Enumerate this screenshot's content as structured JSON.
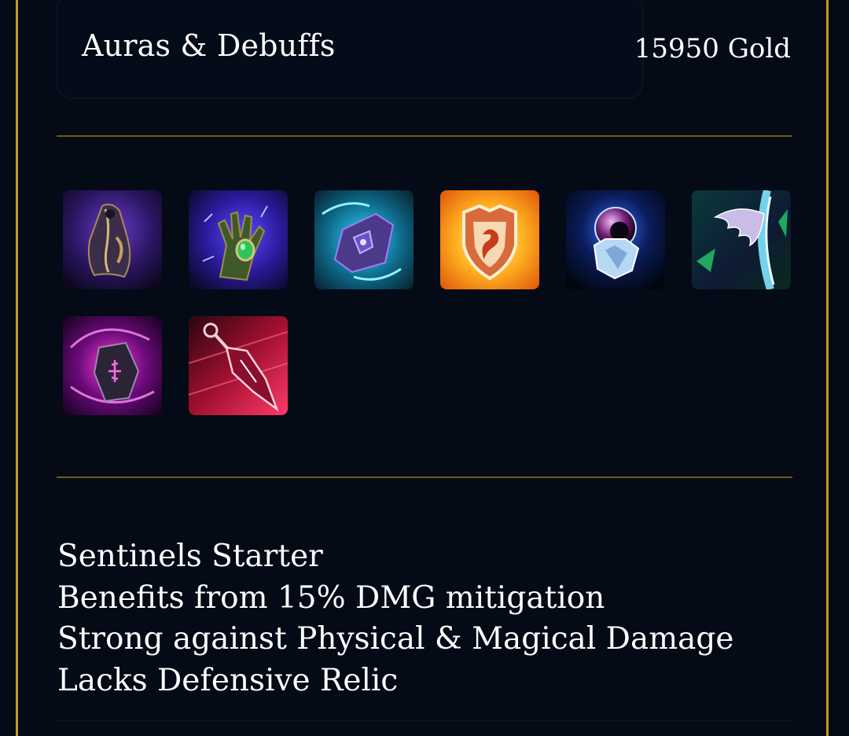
{
  "build": {
    "title": "Auras & Debuffs",
    "cost": "15950 Gold"
  },
  "items": [
    {
      "icon": "shadow-cloak-icon"
    },
    {
      "icon": "emerald-gauntlet-icon"
    },
    {
      "icon": "arcane-crystal-shard-icon"
    },
    {
      "icon": "flame-lion-shield-icon"
    },
    {
      "icon": "frost-orb-icon"
    },
    {
      "icon": "winged-blade-icon"
    },
    {
      "icon": "void-rune-stone-icon"
    },
    {
      "icon": "crimson-pendulum-icon"
    }
  ],
  "notes": [
    "Sentinels Starter",
    "Benefits from 15% DMG mitigation",
    "Strong against Physical & Magical Damage",
    "Lacks Defensive Relic"
  ],
  "colors": {
    "background": "#040a16",
    "frame": "#c99a1e",
    "divider": "#6f5a1e",
    "text": "#ffffff"
  }
}
